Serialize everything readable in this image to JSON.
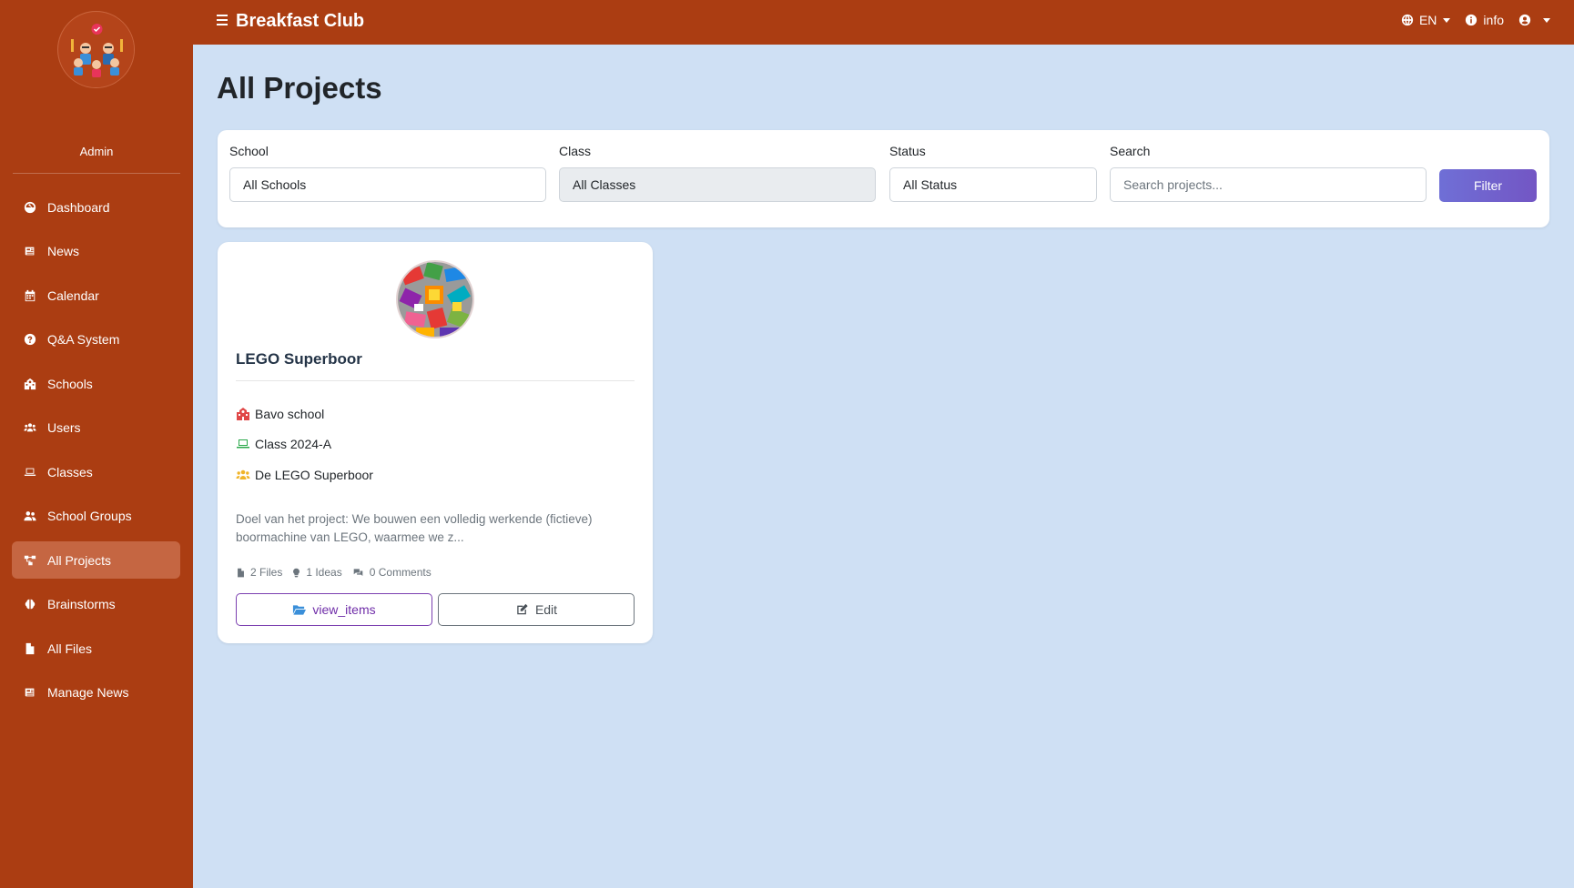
{
  "app": {
    "title": "Breakfast Club",
    "user_role": "Admin"
  },
  "topbar": {
    "language": "EN",
    "info_label": "info"
  },
  "sidebar": {
    "items": [
      {
        "label": "Dashboard",
        "icon": "dashboard-icon"
      },
      {
        "label": "News",
        "icon": "newspaper-icon"
      },
      {
        "label": "Calendar",
        "icon": "calendar-icon"
      },
      {
        "label": "Q&A System",
        "icon": "question-circle-icon"
      },
      {
        "label": "Schools",
        "icon": "school-icon"
      },
      {
        "label": "Users",
        "icon": "users-icon"
      },
      {
        "label": "Classes",
        "icon": "laptop-icon"
      },
      {
        "label": "School Groups",
        "icon": "user-group-icon"
      },
      {
        "label": "All Projects",
        "icon": "project-diagram-icon",
        "active": true
      },
      {
        "label": "Brainstorms",
        "icon": "brain-icon"
      },
      {
        "label": "All Files",
        "icon": "file-icon"
      },
      {
        "label": "Manage News",
        "icon": "newspaper-icon"
      }
    ]
  },
  "page": {
    "title": "All Projects"
  },
  "filters": {
    "school_label": "School",
    "school_value": "All Schools",
    "class_label": "Class",
    "class_value": "All Classes",
    "status_label": "Status",
    "status_value": "All Status",
    "search_label": "Search",
    "search_placeholder": "Search projects...",
    "filter_button": "Filter"
  },
  "projects": [
    {
      "title": "LEGO Superboor",
      "school": "Bavo school",
      "class": "Class 2024-A",
      "group": "De LEGO Superboor",
      "description": "Doel van het project: We bouwen een volledig werkende (fictieve) boormachine van LEGO, waarmee we z...",
      "files": "2 Files",
      "ideas": "1 Ideas",
      "comments": "0 Comments",
      "view_button": "view_items",
      "edit_button": "Edit"
    }
  ],
  "colors": {
    "brand": "#ab3d12",
    "background": "#cfe0f4",
    "active_nav": "#c56642",
    "filter_button": "#7062d0"
  }
}
